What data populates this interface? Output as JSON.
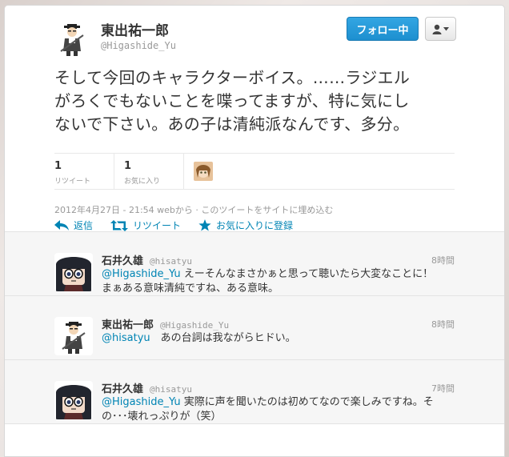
{
  "tweet": {
    "author_name": "東出祐一郎",
    "author_screen": "@Higashide_Yu",
    "follow_label": "フォロー中",
    "text_lines": [
      "そして今回のキャラクターボイス。……ラジエル",
      "がろくでもないことを喋ってますが、特に気にし",
      "ないで下さい。あの子は清純派なんです、多分。"
    ],
    "retweet_count": "1",
    "retweet_label": "リツイート",
    "fav_count": "1",
    "fav_label": "お気に入り",
    "timestamp": "2012年4月27日 - 21:54",
    "via": "webから",
    "separator": "·",
    "embed_link": "このツイートをサイトに埋め込む"
  },
  "actions": {
    "reply": "返信",
    "retweet": "リツイート",
    "favorite": "お気に入りに登録"
  },
  "replies": [
    {
      "name": "石井久雄",
      "screen": "@hisatyu",
      "time": "8時間",
      "mention": "@Higashide_Yu",
      "text_line1": " えーそんなまさかぁと思って聴いたら大変なことに！",
      "text_line2": "まぁある意味清純ですね、ある意味。"
    },
    {
      "name": "東出祐一郎",
      "screen": "@Higashide_Yu",
      "time": "8時間",
      "mention": "@hisatyu",
      "text_line1": "　あの台詞は我ながらヒドい。",
      "text_line2": ""
    },
    {
      "name": "石井久雄",
      "screen": "@hisatyu",
      "time": "7時間",
      "mention": "@Higashide_Yu",
      "text_line1": " 実際に声を聞いたのは初めてなので楽しみですね。そ",
      "text_line2": "の･･･壊れっぷりが（笑）"
    }
  ],
  "colors": {
    "link": "#0084b4",
    "follow_button": "#2b9de0"
  }
}
